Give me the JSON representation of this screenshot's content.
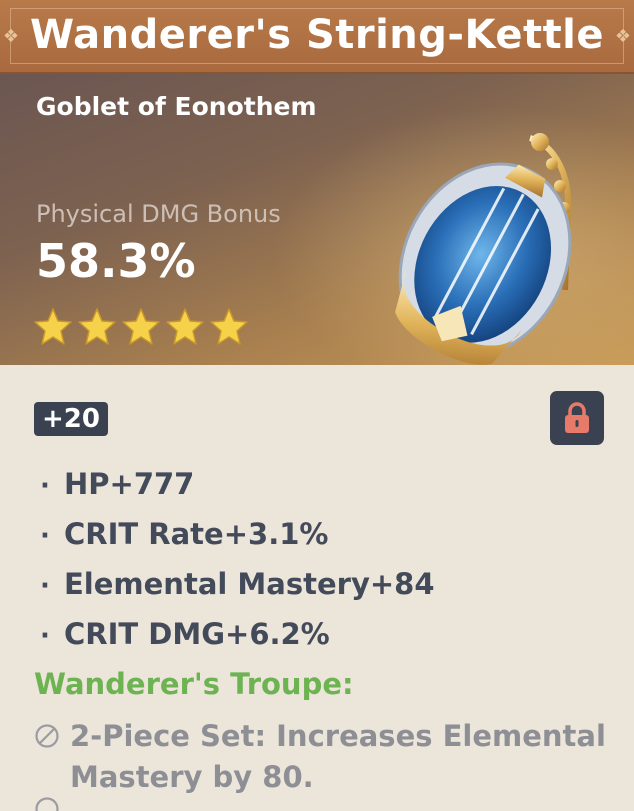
{
  "artifact": {
    "name": "Wanderer's String-Kettle",
    "type": "Goblet of Eonothem",
    "main_stat": {
      "name": "Physical DMG Bonus",
      "value": "58.3%"
    },
    "rarity": 5,
    "level": "+20",
    "locked": true,
    "substats": [
      {
        "label": "HP+777"
      },
      {
        "label": "CRIT Rate+3.1%"
      },
      {
        "label": "Elemental Mastery+84"
      },
      {
        "label": "CRIT DMG+6.2%"
      }
    ],
    "set": {
      "name": "Wanderer's Troupe:",
      "effects": [
        {
          "line1": "2-Piece Set: Increases Elemental",
          "line2": "Mastery by 80."
        }
      ]
    }
  },
  "colors": {
    "title_bar": "#b97a4a",
    "set_name": "#6db352",
    "star": "#f6d24a",
    "badge_bg": "#3a4150",
    "lock_icon": "#e87a6a",
    "substat_text": "#434a5a",
    "inactive_text": "#8d8f95"
  },
  "icons": {
    "lock": "lock-icon",
    "inactive": "circle-slash-icon",
    "star": "star-icon"
  }
}
